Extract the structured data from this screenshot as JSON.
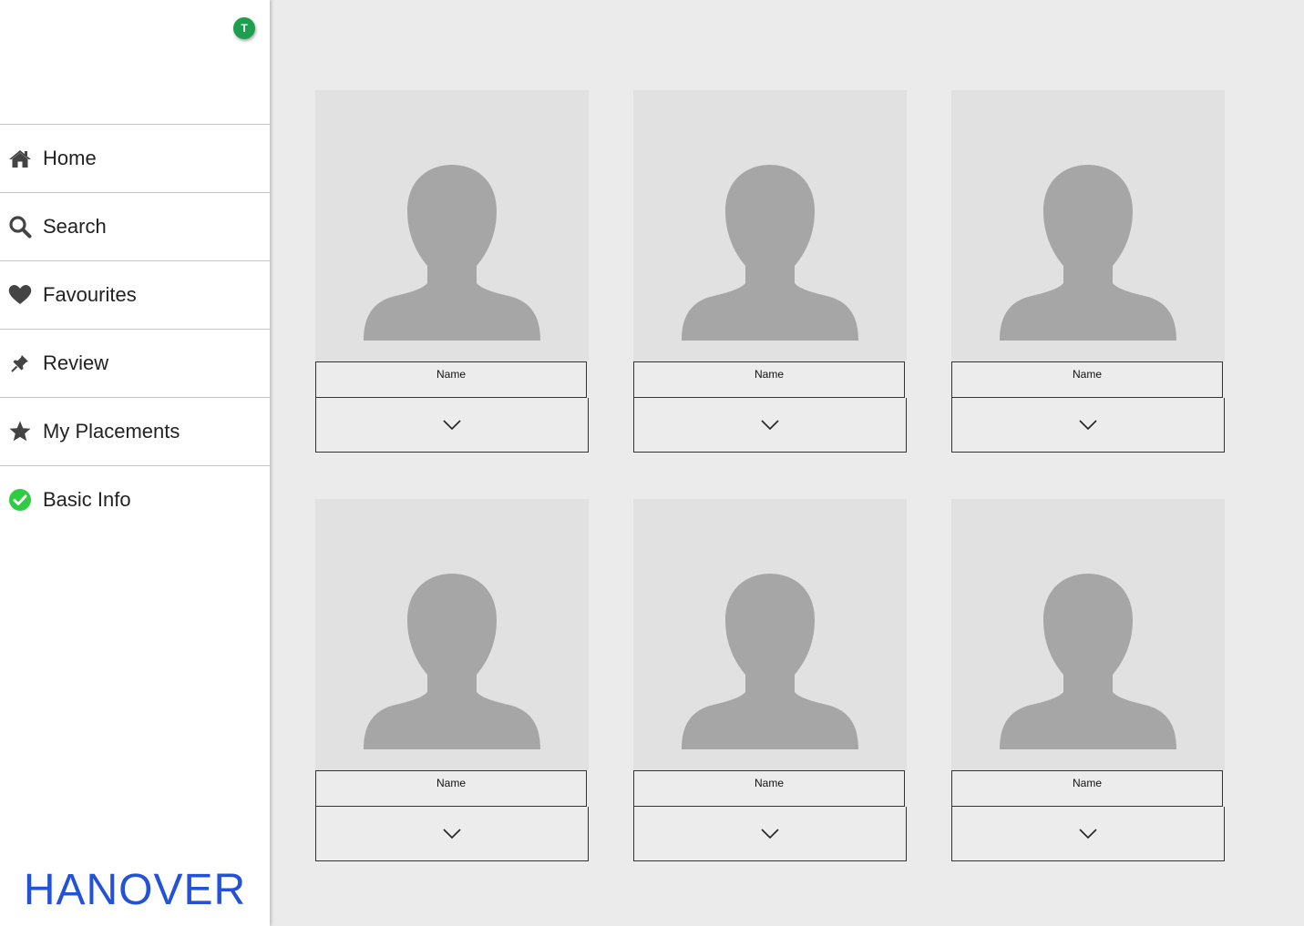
{
  "user": {
    "avatar_initial": "T",
    "avatar_color": "#1e9e4f"
  },
  "sidebar": {
    "items": [
      {
        "label": "Home",
        "icon": "home-icon"
      },
      {
        "label": "Search",
        "icon": "search-icon"
      },
      {
        "label": "Favourites",
        "icon": "heart-icon"
      },
      {
        "label": "Review",
        "icon": "pin-icon"
      },
      {
        "label": "My Placements",
        "icon": "star-icon"
      },
      {
        "label": "Basic Info",
        "icon": "check-circle-icon",
        "icon_color": "#2ecc40"
      }
    ]
  },
  "brand": {
    "name": "HANOVER",
    "color": "#2352d8"
  },
  "profiles": [
    {
      "name": "Name"
    },
    {
      "name": "Name"
    },
    {
      "name": "Name"
    },
    {
      "name": "Name"
    },
    {
      "name": "Name"
    },
    {
      "name": "Name"
    }
  ]
}
